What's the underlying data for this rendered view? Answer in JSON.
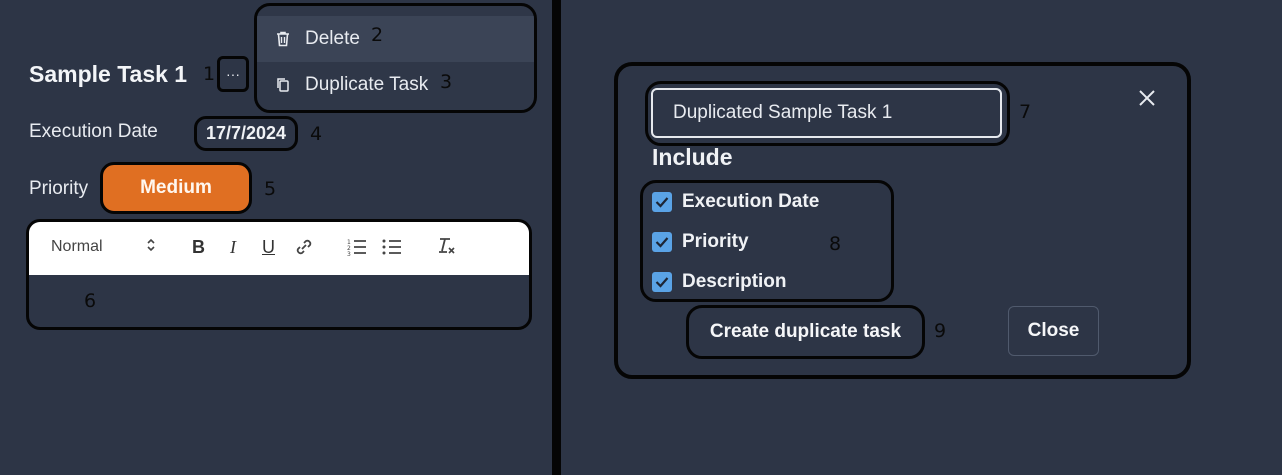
{
  "task": {
    "title": "Sample Task 1",
    "more_icon": "ellipsis-icon",
    "execution_date_label": "Execution Date",
    "execution_date_value": "17/7/2024",
    "priority_label": "Priority",
    "priority_value": "Medium",
    "priority_color": "#e06f22"
  },
  "context_menu": {
    "items": [
      {
        "label": "Delete",
        "icon": "trash-icon"
      },
      {
        "label": "Duplicate Task",
        "icon": "copy-icon"
      }
    ]
  },
  "editor": {
    "format_select": "Normal",
    "tools": [
      "bold-icon",
      "italic-icon",
      "underline-icon",
      "link-icon",
      "ordered-list-icon",
      "bullet-list-icon",
      "clear-format-icon"
    ]
  },
  "duplicate_dialog": {
    "name_value": "Duplicated Sample Task 1",
    "include_heading": "Include",
    "options": [
      {
        "label": "Execution Date",
        "checked": true
      },
      {
        "label": "Priority",
        "checked": true
      },
      {
        "label": "Description",
        "checked": true
      }
    ],
    "create_label": "Create duplicate task",
    "close_label": "Close",
    "accent_color": "#5aa3e6"
  },
  "annotations": {
    "a1": "1",
    "a2": "2",
    "a3": "3",
    "a4": "4",
    "a5": "5",
    "a6": "6",
    "a7": "7",
    "a8": "8",
    "a9": "9"
  }
}
